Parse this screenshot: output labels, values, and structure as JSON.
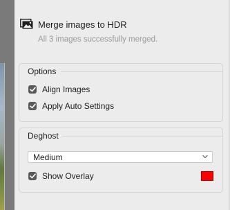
{
  "header": {
    "icon": "images-icon",
    "title": "Merge images to HDR",
    "subtitle": "All 3 images successfully merged."
  },
  "options": {
    "title": "Options",
    "align_images": {
      "label": "Align Images",
      "checked": true
    },
    "apply_auto_settings": {
      "label": "Apply Auto Settings",
      "checked": true
    }
  },
  "deghost": {
    "title": "Deghost",
    "select": {
      "value": "Medium"
    },
    "show_overlay": {
      "label": "Show Overlay",
      "checked": true
    },
    "overlay_color": "#ff0000"
  }
}
